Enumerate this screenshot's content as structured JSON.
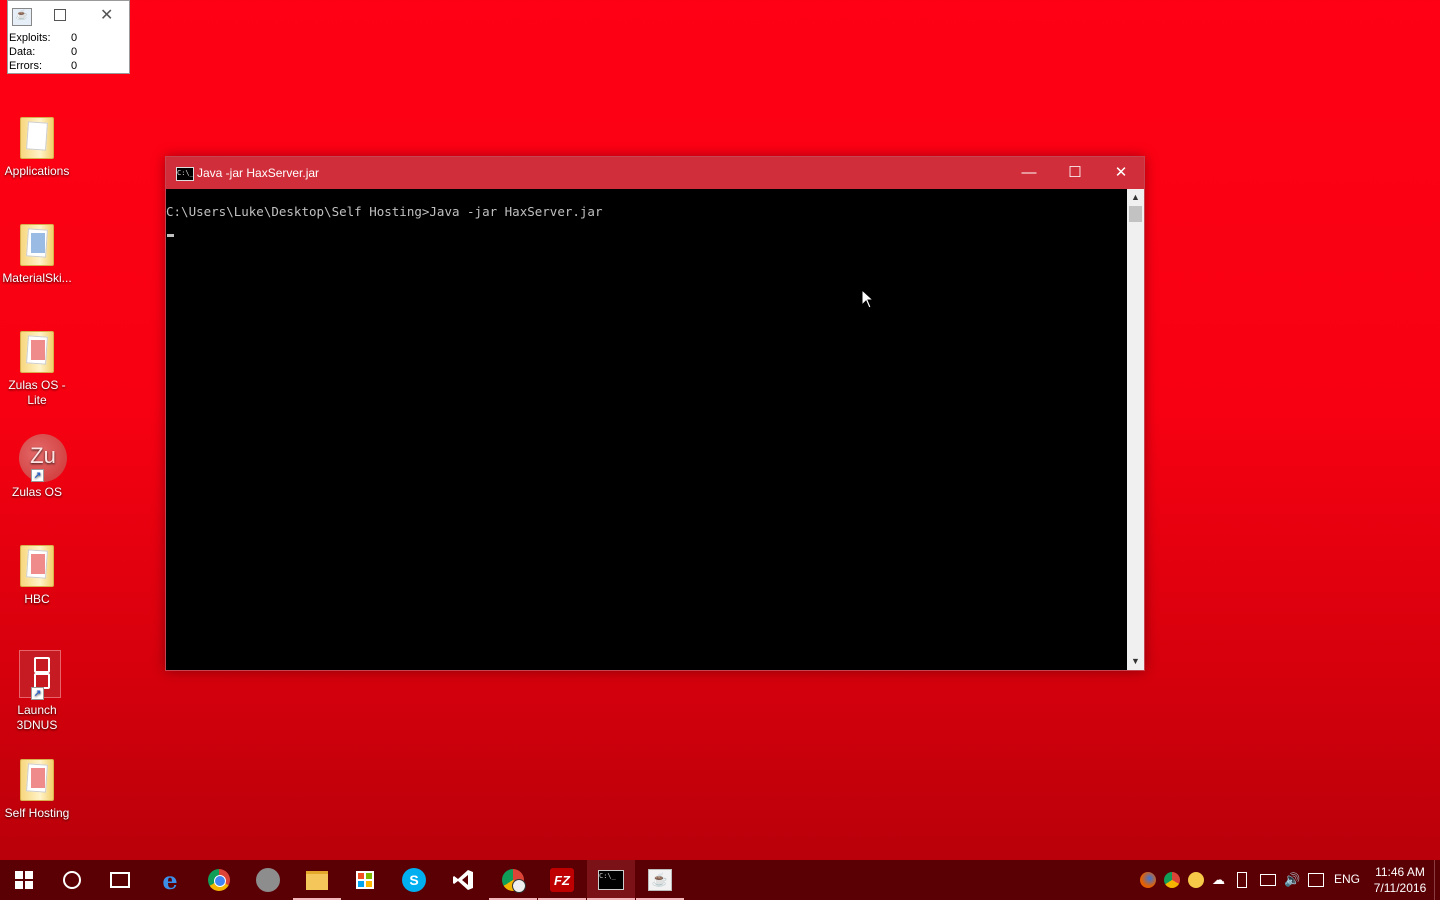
{
  "desktop": {
    "icons": [
      {
        "label": "Applications",
        "icon": "folder-icon"
      },
      {
        "label": "MaterialSki...",
        "icon": "folder-icon"
      },
      {
        "label": "Zulas OS - Lite",
        "icon": "folder-icon"
      },
      {
        "label": "Zulas OS",
        "icon": "shortcut-icon",
        "badge": "Zu"
      },
      {
        "label": "HBC",
        "icon": "folder-icon"
      },
      {
        "label": "Launch 3DNUS",
        "icon": "shortcut-icon"
      },
      {
        "label": "Self Hosting",
        "icon": "folder-icon"
      }
    ]
  },
  "stats_window": {
    "rows": [
      {
        "label": "Exploits:",
        "value": "0"
      },
      {
        "label": "Data:",
        "value": "0"
      },
      {
        "label": "Errors:",
        "value": "0"
      }
    ]
  },
  "console_window": {
    "title": "Java  -jar HaxServer.jar",
    "icon_text": "C:\\_",
    "minimize_label": "—",
    "maximize_label": "☐",
    "close_label": "✕",
    "command_line": "C:\\Users\\Luke\\Desktop\\Self Hosting>Java -jar HaxServer.jar"
  },
  "taskbar": {
    "start_icon": "windows-start-icon",
    "apps": [
      {
        "name": "cortana",
        "icon": "search-circle-icon"
      },
      {
        "name": "task-view",
        "icon": "task-view-icon"
      },
      {
        "name": "edge",
        "icon": "edge-icon",
        "glyph": "e"
      },
      {
        "name": "chrome",
        "icon": "chrome-icon"
      },
      {
        "name": "app-grey",
        "icon": "grey-circle-icon"
      },
      {
        "name": "file-explorer",
        "icon": "folder-icon"
      },
      {
        "name": "store",
        "icon": "store-icon"
      },
      {
        "name": "skype",
        "icon": "skype-icon",
        "glyph": "S"
      },
      {
        "name": "visual-studio",
        "icon": "visual-studio-icon"
      },
      {
        "name": "chrome-user",
        "icon": "chrome-user-icon"
      },
      {
        "name": "filezilla",
        "icon": "filezilla-icon",
        "glyph": "FZ"
      },
      {
        "name": "cmd",
        "icon": "command-prompt-icon",
        "glyph": "C:\\_"
      },
      {
        "name": "java",
        "icon": "java-icon"
      }
    ],
    "tray": {
      "language": "ENG",
      "time": "11:46 AM",
      "date": "7/11/2016"
    }
  },
  "colors": {
    "desktop_top": "#ff0014",
    "desktop_bottom": "#b3000a",
    "titlebar": "#cf2e3a",
    "taskbar": "#5a0005"
  }
}
